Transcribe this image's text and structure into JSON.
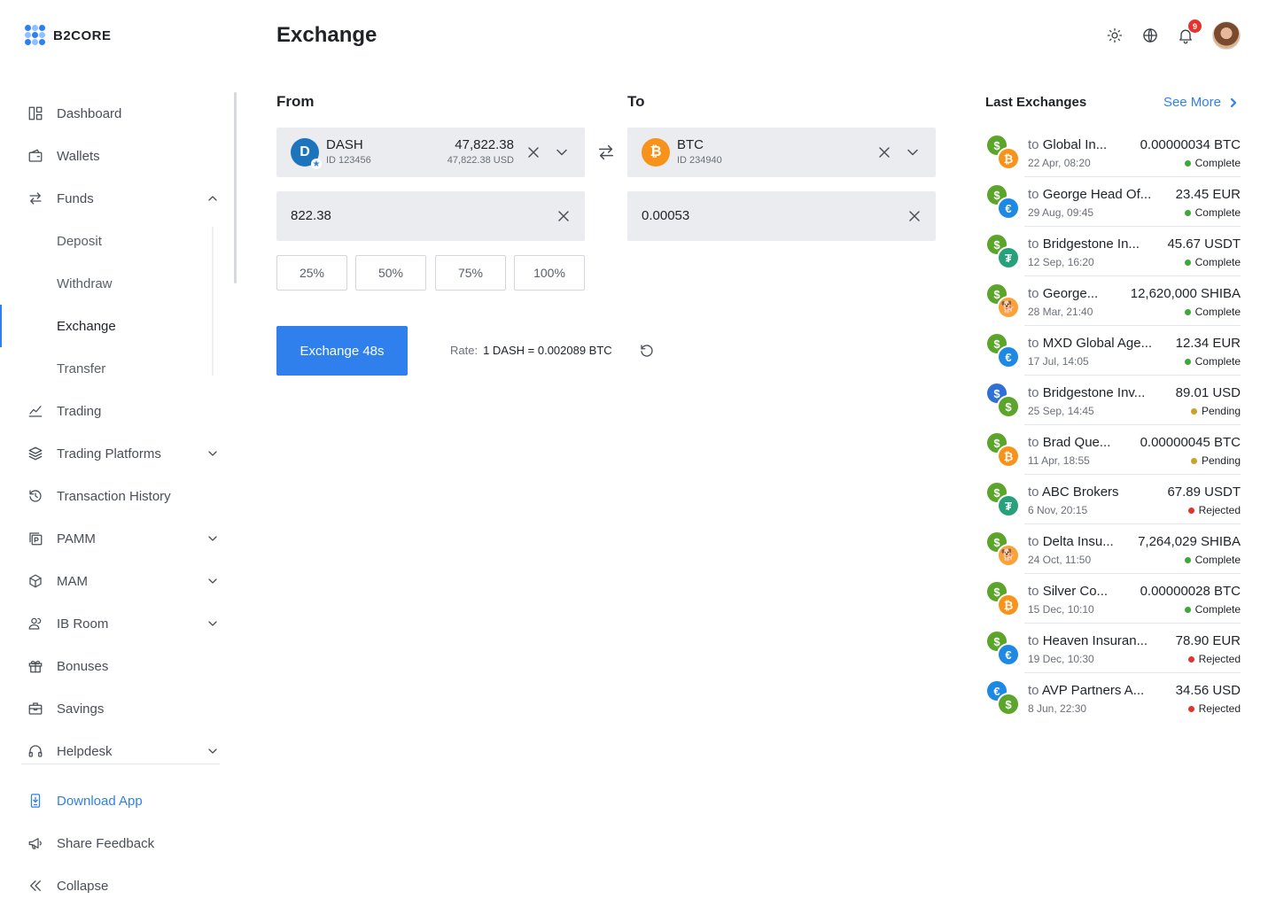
{
  "brand": {
    "name": "B2CORE",
    "accent": "#2f80ed"
  },
  "page": {
    "title": "Exchange"
  },
  "topbar": {
    "icons": [
      "sun-icon",
      "globe-icon",
      "bell-icon",
      "avatar"
    ],
    "notifications_count": "9"
  },
  "sidebar": {
    "items": [
      {
        "label": "Dashboard",
        "icon": "dashboard-icon"
      },
      {
        "label": "Wallets",
        "icon": "wallet-icon"
      },
      {
        "label": "Funds",
        "icon": "transfer-arrows-icon",
        "expanded": true
      },
      {
        "label": "Deposit",
        "sub": true
      },
      {
        "label": "Withdraw",
        "sub": true
      },
      {
        "label": "Exchange",
        "sub": true,
        "active": true
      },
      {
        "label": "Transfer",
        "sub": true
      },
      {
        "label": "Trading",
        "icon": "chart-line-icon"
      },
      {
        "label": "Trading Platforms",
        "icon": "layers-icon",
        "expandable": true
      },
      {
        "label": "Transaction History",
        "icon": "history-icon"
      },
      {
        "label": "PAMM",
        "icon": "pamm-icon",
        "expandable": true
      },
      {
        "label": "MAM",
        "icon": "cube-icon",
        "expandable": true
      },
      {
        "label": "IB Room",
        "icon": "users-icon",
        "expandable": true
      },
      {
        "label": "Bonuses",
        "icon": "gift-icon"
      },
      {
        "label": "Savings",
        "icon": "briefcase-icon"
      },
      {
        "label": "Helpdesk",
        "icon": "headset-icon",
        "expandable": true
      }
    ],
    "footer": [
      {
        "label": "Download App",
        "icon": "mobile-download-icon"
      },
      {
        "label": "Share Feedback",
        "icon": "megaphone-icon"
      },
      {
        "label": "Collapse",
        "icon": "chevrons-left-icon"
      }
    ]
  },
  "exchange": {
    "from_label": "From",
    "to_label": "To",
    "from": {
      "name": "DASH",
      "id": "ID 123456",
      "amount": "47,822.38",
      "usd": "47,822.38 USD",
      "icon": "dash-coin-icon",
      "glyph": "D"
    },
    "to": {
      "name": "BTC",
      "id": "ID 234940",
      "icon": "btc-coin-icon",
      "glyph": "₿"
    },
    "from_amount": "822.38",
    "to_amount": "0.00053",
    "percents": [
      "25%",
      "50%",
      "75%",
      "100%"
    ],
    "button_label": "Exchange 48s",
    "rate_label": "Rate:",
    "rate_value": "1 DASH = 0.002089 BTC"
  },
  "last_exchanges": {
    "title": "Last Exchanges",
    "see_more": "See More",
    "prefix": "to",
    "status_colors": {
      "Complete": "#3aa935",
      "Pending": "#c9a227",
      "Rejected": "#e5322d"
    },
    "coin_colors": {
      "usd": "#5aa52a",
      "btc": "#f7931a",
      "eur": "#1e88e5",
      "usdt": "#26a17b",
      "shiba": "#f9a23a",
      "usdc": "#2f6fd6"
    },
    "items": [
      {
        "to": "Global In...",
        "date": "22 Apr, 08:20",
        "amount": "0.00000034 BTC",
        "status": "Complete",
        "from_coin": "usd",
        "to_coin": "btc"
      },
      {
        "to": "George Head Of...",
        "date": "29 Aug, 09:45",
        "amount": "23.45 EUR",
        "status": "Complete",
        "from_coin": "usd",
        "to_coin": "eur"
      },
      {
        "to": "Bridgestone In...",
        "date": "12 Sep, 16:20",
        "amount": "45.67 USDT",
        "status": "Complete",
        "from_coin": "usd",
        "to_coin": "usdt"
      },
      {
        "to": "George...",
        "date": "28 Mar, 21:40",
        "amount": "12,620,000 SHIBA",
        "status": "Complete",
        "from_coin": "usd",
        "to_coin": "shiba"
      },
      {
        "to": "MXD Global Age...",
        "date": "17 Jul, 14:05",
        "amount": "12.34 EUR",
        "status": "Complete",
        "from_coin": "usd",
        "to_coin": "eur"
      },
      {
        "to": "Bridgestone Inv...",
        "date": "25 Sep, 14:45",
        "amount": "89.01 USD",
        "status": "Pending",
        "from_coin": "usdc",
        "to_coin": "usd"
      },
      {
        "to": "Brad Que...",
        "date": "11 Apr, 18:55",
        "amount": "0.00000045 BTC",
        "status": "Pending",
        "from_coin": "usd",
        "to_coin": "btc"
      },
      {
        "to": "ABC Brokers",
        "date": "6 Nov, 20:15",
        "amount": "67.89 USDT",
        "status": "Rejected",
        "from_coin": "usd",
        "to_coin": "usdt"
      },
      {
        "to": "Delta Insu...",
        "date": "24 Oct, 11:50",
        "amount": "7,264,029 SHIBA",
        "status": "Complete",
        "from_coin": "usd",
        "to_coin": "shiba"
      },
      {
        "to": "Silver Co...",
        "date": "15 Dec, 10:10",
        "amount": "0.00000028 BTC",
        "status": "Complete",
        "from_coin": "usd",
        "to_coin": "btc"
      },
      {
        "to": "Heaven Insuran...",
        "date": "19 Dec, 10:30",
        "amount": "78.90 EUR",
        "status": "Rejected",
        "from_coin": "usd",
        "to_coin": "eur"
      },
      {
        "to": "AVP Partners A...",
        "date": "8 Jun, 22:30",
        "amount": "34.56 USD",
        "status": "Rejected",
        "from_coin": "eur",
        "to_coin": "usd"
      }
    ]
  }
}
